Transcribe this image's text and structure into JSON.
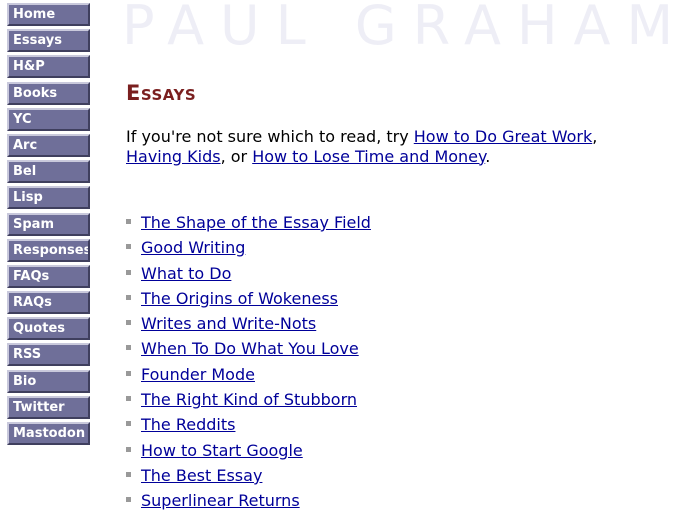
{
  "nav": {
    "items": [
      {
        "label": "Home"
      },
      {
        "label": "Essays"
      },
      {
        "label": "H&P"
      },
      {
        "label": "Books"
      },
      {
        "label": "YC"
      },
      {
        "label": "Arc"
      },
      {
        "label": "Bel"
      },
      {
        "label": "Lisp"
      },
      {
        "label": "Spam"
      },
      {
        "label": "Responses"
      },
      {
        "label": "FAQs"
      },
      {
        "label": "RAQs"
      },
      {
        "label": "Quotes"
      },
      {
        "label": "RSS"
      },
      {
        "label": "Bio"
      },
      {
        "label": "Twitter"
      },
      {
        "label": "Mastodon"
      }
    ],
    "button_color": "#6f6f99"
  },
  "header": {
    "logo_text": "PAUL GRAHAM"
  },
  "main": {
    "title": "Essays",
    "title_color": "#7a1f1f",
    "intro": {
      "prefix": "If you're not sure which to read, try ",
      "link1": "How to Do Great Work",
      "sep1": ", ",
      "link2": "Having Kids",
      "sep2": ", or ",
      "link3": "How to Lose Time and Money",
      "suffix": "."
    },
    "link_color": "#000099",
    "essays": [
      {
        "title": "The Shape of the Essay Field"
      },
      {
        "title": "Good Writing"
      },
      {
        "title": "What to Do"
      },
      {
        "title": "The Origins of Wokeness"
      },
      {
        "title": "Writes and Write-Nots"
      },
      {
        "title": "When To Do What You Love"
      },
      {
        "title": "Founder Mode"
      },
      {
        "title": "The Right Kind of Stubborn"
      },
      {
        "title": "The Reddits"
      },
      {
        "title": "How to Start Google"
      },
      {
        "title": "The Best Essay"
      },
      {
        "title": "Superlinear Returns"
      }
    ]
  }
}
